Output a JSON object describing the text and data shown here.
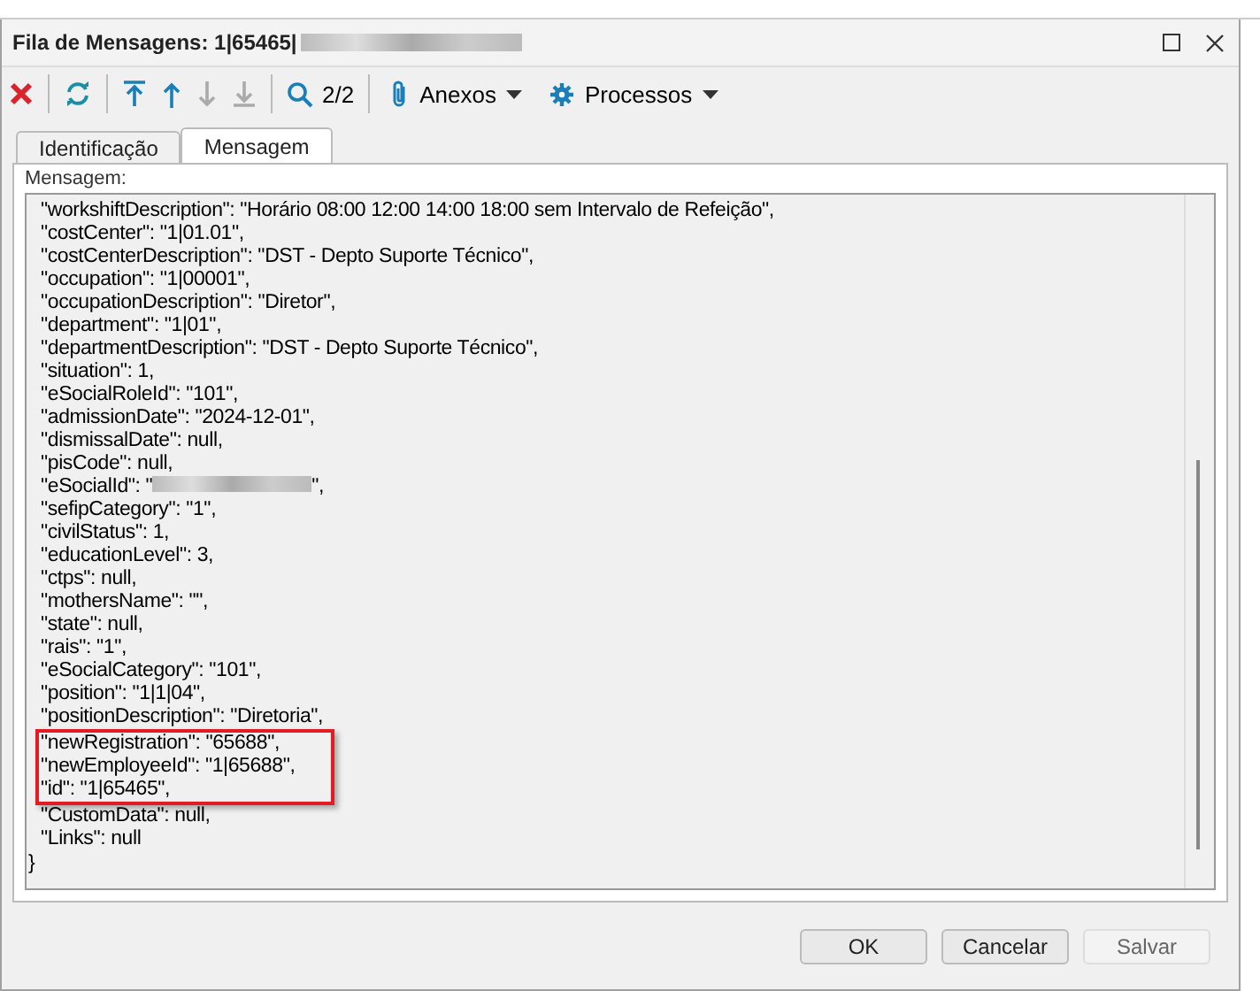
{
  "window": {
    "title": "Fila de Mensagens: 1|65465|",
    "title_redacted": true
  },
  "toolbar": [
    {
      "kind": "delete",
      "disabled": false
    },
    {
      "kind": "refresh",
      "disabled": false
    },
    {
      "kind": "first",
      "disabled": false
    },
    {
      "kind": "up",
      "disabled": false
    },
    {
      "kind": "down",
      "disabled": true
    },
    {
      "kind": "last",
      "disabled": true
    },
    {
      "kind": "search",
      "disabled": false,
      "label": "2/2"
    },
    {
      "kind": "attach",
      "disabled": false,
      "label": "Anexos"
    },
    {
      "kind": "gear",
      "disabled": false,
      "label": "Processos"
    }
  ],
  "tabs": [
    {
      "label": "Identificação",
      "selected": false
    },
    {
      "label": "Mensagem",
      "selected": true
    }
  ],
  "message": {
    "label": "Mensagem:",
    "lines": [
      {
        "kind": "entry",
        "text": "\"workshiftDescription\": \"Horário 08:00 12:00 14:00 18:00 sem Intervalo de Refeição\",",
        "highlighted": false
      },
      {
        "kind": "entry",
        "text": "\"costCenter\": \"1|01.01\",",
        "highlighted": false
      },
      {
        "kind": "entry",
        "text": "\"costCenterDescription\": \"DST - Depto Suporte Técnico\",",
        "highlighted": false
      },
      {
        "kind": "entry",
        "text": "\"occupation\": \"1|00001\",",
        "highlighted": false
      },
      {
        "kind": "entry",
        "text": "\"occupationDescription\": \"Diretor\",",
        "highlighted": false
      },
      {
        "kind": "entry",
        "text": "\"department\": \"1|01\",",
        "highlighted": false
      },
      {
        "kind": "entry",
        "text": "\"departmentDescription\": \"DST - Depto Suporte Técnico\",",
        "highlighted": false
      },
      {
        "kind": "entry",
        "text": "\"situation\": 1,",
        "highlighted": false
      },
      {
        "kind": "entry",
        "text": "\"eSocialRoleId\": \"101\",",
        "highlighted": false
      },
      {
        "kind": "entry",
        "text": "\"admissionDate\": \"2024-12-01\",",
        "highlighted": false
      },
      {
        "kind": "entry",
        "text": "\"dismissalDate\": null,",
        "highlighted": false
      },
      {
        "kind": "entry",
        "text": "\"pisCode\": null,",
        "highlighted": false
      },
      {
        "kind": "redacted",
        "text": "\"eSocialId\": \"",
        "after": "\",",
        "highlighted": false
      },
      {
        "kind": "entry",
        "text": "\"sefipCategory\": \"1\",",
        "highlighted": false
      },
      {
        "kind": "entry",
        "text": "\"civilStatus\": 1,",
        "highlighted": false
      },
      {
        "kind": "entry",
        "text": "\"educationLevel\": 3,",
        "highlighted": false
      },
      {
        "kind": "entry",
        "text": "\"ctps\": null,",
        "highlighted": false
      },
      {
        "kind": "entry",
        "text": "\"mothersName\": \"\",",
        "highlighted": false
      },
      {
        "kind": "entry",
        "text": "\"state\": null,",
        "highlighted": false
      },
      {
        "kind": "entry",
        "text": "\"rais\": \"1\",",
        "highlighted": false
      },
      {
        "kind": "entry",
        "text": "\"eSocialCategory\": \"101\",",
        "highlighted": false
      },
      {
        "kind": "entry",
        "text": "\"position\": \"1|1|04\",",
        "highlighted": false
      },
      {
        "kind": "entry",
        "text": "\"positionDescription\": \"Diretoria\",",
        "highlighted": false
      },
      {
        "kind": "entry",
        "text": "\"newRegistration\": \"65688\",",
        "highlighted": true
      },
      {
        "kind": "entry",
        "text": "\"newEmployeeId\": \"1|65688\",",
        "highlighted": true
      },
      {
        "kind": "entry",
        "text": "\"id\": \"1|65465\",",
        "highlighted": true
      },
      {
        "kind": "entry",
        "text": "\"CustomData\": null,",
        "highlighted": false
      },
      {
        "kind": "entry",
        "text": "\"Links\": null",
        "highlighted": false
      },
      {
        "kind": "brace",
        "text": "}",
        "highlighted": false
      }
    ]
  },
  "buttons": [
    {
      "label": "OK",
      "disabled": false
    },
    {
      "label": "Cancelar",
      "disabled": false
    },
    {
      "label": "Salvar",
      "disabled": true
    }
  ]
}
